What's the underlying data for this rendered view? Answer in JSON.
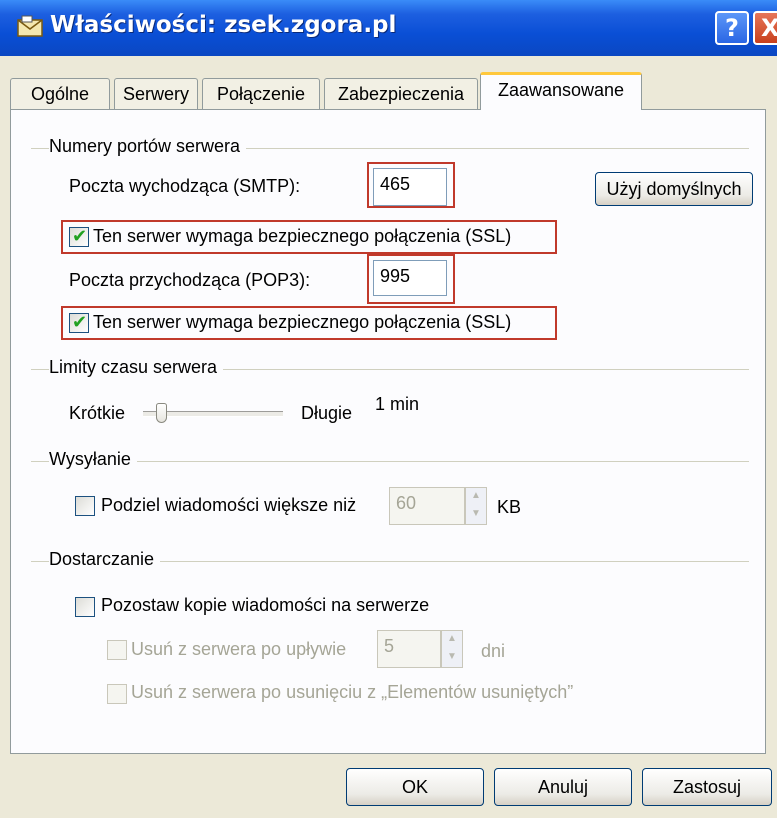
{
  "window": {
    "title": "Właściwości: zsek.zgora.pl",
    "help_label": "?",
    "close_label": "X"
  },
  "tabs": [
    {
      "label": "Ogólne"
    },
    {
      "label": "Serwery"
    },
    {
      "label": "Połączenie"
    },
    {
      "label": "Zabezpieczenia"
    },
    {
      "label": "Zaawansowane",
      "active": true
    }
  ],
  "ports": {
    "group_title": "Numery portów serwera",
    "smtp_label": "Poczta wychodząca (SMTP):",
    "smtp_value": "465",
    "use_default_label": "Użyj domyślnych",
    "smtp_ssl_label": "Ten serwer wymaga bezpiecznego połączenia (SSL)",
    "smtp_ssl_checked": true,
    "pop3_label": "Poczta przychodząca (POP3):",
    "pop3_value": "995",
    "pop3_ssl_label": "Ten serwer wymaga bezpiecznego połączenia (SSL)",
    "pop3_ssl_checked": true
  },
  "timeouts": {
    "group_title": "Limity czasu serwera",
    "short_label": "Krótkie",
    "long_label": "Długie",
    "value_label": "1 min",
    "slider_fraction": 0.1
  },
  "sending": {
    "group_title": "Wysyłanie",
    "split_label": "Podziel wiadomości większe niż",
    "split_checked": false,
    "split_value": "60",
    "unit_label": "KB"
  },
  "delivery": {
    "group_title": "Dostarczanie",
    "leave_copy_label": "Pozostaw kopie wiadomości na serwerze",
    "leave_copy_checked": false,
    "remove_after_label": "Usuń z serwera po upływie",
    "remove_after_value": "5",
    "days_label": "dni",
    "remove_deleted_label": "Usuń z serwera po usunięciu z „Elementów usuniętych”"
  },
  "buttons": {
    "ok": "OK",
    "cancel": "Anuluj",
    "apply": "Zastosuj"
  },
  "colors": {
    "titlebar": "#0a4fd6",
    "highlight_box": "#c0392b",
    "active_tab_accent": "#ffc83c",
    "check": "#21a121"
  }
}
